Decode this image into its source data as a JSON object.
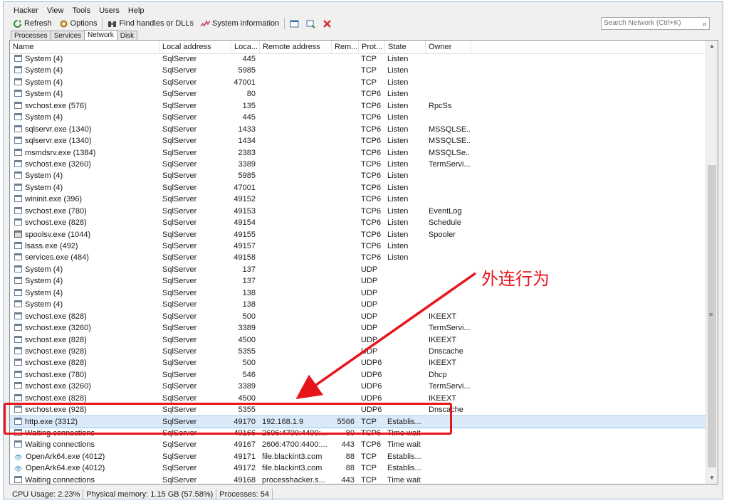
{
  "menu": [
    "Hacker",
    "View",
    "Tools",
    "Users",
    "Help"
  ],
  "toolbar": {
    "refresh": "Refresh",
    "options": "Options",
    "find": "Find handles or DLLs",
    "sysinfo": "System information",
    "search_placeholder": "Search Network (Ctrl+K)"
  },
  "tabs": [
    "Processes",
    "Services",
    "Network",
    "Disk"
  ],
  "columns": [
    "Name",
    "Local address",
    "Loca...",
    "Remote address",
    "Rem...",
    "Prot...",
    "State",
    "Owner"
  ],
  "rows": [
    {
      "icon": "process",
      "name": "System (4)",
      "local": "SqlServer",
      "lport": "445",
      "remote": "",
      "rport": "",
      "proto": "TCP",
      "state": "Listen",
      "owner": ""
    },
    {
      "icon": "process",
      "name": "System (4)",
      "local": "SqlServer",
      "lport": "5985",
      "remote": "",
      "rport": "",
      "proto": "TCP",
      "state": "Listen",
      "owner": ""
    },
    {
      "icon": "process",
      "name": "System (4)",
      "local": "SqlServer",
      "lport": "47001",
      "remote": "",
      "rport": "",
      "proto": "TCP",
      "state": "Listen",
      "owner": ""
    },
    {
      "icon": "process",
      "name": "System (4)",
      "local": "SqlServer",
      "lport": "80",
      "remote": "",
      "rport": "",
      "proto": "TCP6",
      "state": "Listen",
      "owner": ""
    },
    {
      "icon": "process",
      "name": "svchost.exe (576)",
      "local": "SqlServer",
      "lport": "135",
      "remote": "",
      "rport": "",
      "proto": "TCP6",
      "state": "Listen",
      "owner": "RpcSs"
    },
    {
      "icon": "process",
      "name": "System (4)",
      "local": "SqlServer",
      "lport": "445",
      "remote": "",
      "rport": "",
      "proto": "TCP6",
      "state": "Listen",
      "owner": ""
    },
    {
      "icon": "process",
      "name": "sqlservr.exe (1340)",
      "local": "SqlServer",
      "lport": "1433",
      "remote": "",
      "rport": "",
      "proto": "TCP6",
      "state": "Listen",
      "owner": "MSSQLSE..."
    },
    {
      "icon": "process",
      "name": "sqlservr.exe (1340)",
      "local": "SqlServer",
      "lport": "1434",
      "remote": "",
      "rport": "",
      "proto": "TCP6",
      "state": "Listen",
      "owner": "MSSQLSE..."
    },
    {
      "icon": "process",
      "name": "msmdsrv.exe (1384)",
      "local": "SqlServer",
      "lport": "2383",
      "remote": "",
      "rport": "",
      "proto": "TCP6",
      "state": "Listen",
      "owner": "MSSQLSe..."
    },
    {
      "icon": "process",
      "name": "svchost.exe (3260)",
      "local": "SqlServer",
      "lport": "3389",
      "remote": "",
      "rport": "",
      "proto": "TCP6",
      "state": "Listen",
      "owner": "TermServi..."
    },
    {
      "icon": "process",
      "name": "System (4)",
      "local": "SqlServer",
      "lport": "5985",
      "remote": "",
      "rport": "",
      "proto": "TCP6",
      "state": "Listen",
      "owner": ""
    },
    {
      "icon": "process",
      "name": "System (4)",
      "local": "SqlServer",
      "lport": "47001",
      "remote": "",
      "rport": "",
      "proto": "TCP6",
      "state": "Listen",
      "owner": ""
    },
    {
      "icon": "process",
      "name": "wininit.exe (396)",
      "local": "SqlServer",
      "lport": "49152",
      "remote": "",
      "rport": "",
      "proto": "TCP6",
      "state": "Listen",
      "owner": ""
    },
    {
      "icon": "process",
      "name": "svchost.exe (780)",
      "local": "SqlServer",
      "lport": "49153",
      "remote": "",
      "rport": "",
      "proto": "TCP6",
      "state": "Listen",
      "owner": "EventLog"
    },
    {
      "icon": "process",
      "name": "svchost.exe (828)",
      "local": "SqlServer",
      "lport": "49154",
      "remote": "",
      "rport": "",
      "proto": "TCP6",
      "state": "Listen",
      "owner": "Schedule"
    },
    {
      "icon": "printer",
      "name": "spoolsv.exe (1044)",
      "local": "SqlServer",
      "lport": "49155",
      "remote": "",
      "rport": "",
      "proto": "TCP6",
      "state": "Listen",
      "owner": "Spooler"
    },
    {
      "icon": "process",
      "name": "lsass.exe (492)",
      "local": "SqlServer",
      "lport": "49157",
      "remote": "",
      "rport": "",
      "proto": "TCP6",
      "state": "Listen",
      "owner": ""
    },
    {
      "icon": "process",
      "name": "services.exe (484)",
      "local": "SqlServer",
      "lport": "49158",
      "remote": "",
      "rport": "",
      "proto": "TCP6",
      "state": "Listen",
      "owner": ""
    },
    {
      "icon": "process",
      "name": "System (4)",
      "local": "SqlServer",
      "lport": "137",
      "remote": "",
      "rport": "",
      "proto": "UDP",
      "state": "",
      "owner": ""
    },
    {
      "icon": "process",
      "name": "System (4)",
      "local": "SqlServer",
      "lport": "137",
      "remote": "",
      "rport": "",
      "proto": "UDP",
      "state": "",
      "owner": ""
    },
    {
      "icon": "process",
      "name": "System (4)",
      "local": "SqlServer",
      "lport": "138",
      "remote": "",
      "rport": "",
      "proto": "UDP",
      "state": "",
      "owner": ""
    },
    {
      "icon": "process",
      "name": "System (4)",
      "local": "SqlServer",
      "lport": "138",
      "remote": "",
      "rport": "",
      "proto": "UDP",
      "state": "",
      "owner": ""
    },
    {
      "icon": "process",
      "name": "svchost.exe (828)",
      "local": "SqlServer",
      "lport": "500",
      "remote": "",
      "rport": "",
      "proto": "UDP",
      "state": "",
      "owner": "IKEEXT"
    },
    {
      "icon": "process",
      "name": "svchost.exe (3260)",
      "local": "SqlServer",
      "lport": "3389",
      "remote": "",
      "rport": "",
      "proto": "UDP",
      "state": "",
      "owner": "TermServi..."
    },
    {
      "icon": "process",
      "name": "svchost.exe (828)",
      "local": "SqlServer",
      "lport": "4500",
      "remote": "",
      "rport": "",
      "proto": "UDP",
      "state": "",
      "owner": "IKEEXT"
    },
    {
      "icon": "process",
      "name": "svchost.exe (928)",
      "local": "SqlServer",
      "lport": "5355",
      "remote": "",
      "rport": "",
      "proto": "UDP",
      "state": "",
      "owner": "Dnscache"
    },
    {
      "icon": "process",
      "name": "svchost.exe (828)",
      "local": "SqlServer",
      "lport": "500",
      "remote": "",
      "rport": "",
      "proto": "UDP6",
      "state": "",
      "owner": "IKEEXT"
    },
    {
      "icon": "process",
      "name": "svchost.exe (780)",
      "local": "SqlServer",
      "lport": "546",
      "remote": "",
      "rport": "",
      "proto": "UDP6",
      "state": "",
      "owner": "Dhcp"
    },
    {
      "icon": "process",
      "name": "svchost.exe (3260)",
      "local": "SqlServer",
      "lport": "3389",
      "remote": "",
      "rport": "",
      "proto": "UDP6",
      "state": "",
      "owner": "TermServi..."
    },
    {
      "icon": "process",
      "name": "svchost.exe (828)",
      "local": "SqlServer",
      "lport": "4500",
      "remote": "",
      "rport": "",
      "proto": "UDP6",
      "state": "",
      "owner": "IKEEXT"
    },
    {
      "icon": "process",
      "name": "svchost.exe (928)",
      "local": "SqlServer",
      "lport": "5355",
      "remote": "",
      "rport": "",
      "proto": "UDP6",
      "state": "",
      "owner": "Dnscache"
    },
    {
      "icon": "process",
      "name": "http.exe (3312)",
      "local": "SqlServer",
      "lport": "49170",
      "remote": "192.168.1.9",
      "rport": "5566",
      "proto": "TCP",
      "state": "Establis...",
      "owner": "",
      "selected": true
    },
    {
      "icon": "process",
      "name": "Waiting connections",
      "local": "SqlServer",
      "lport": "49166",
      "remote": "2606:4700:4400:...",
      "rport": "80",
      "proto": "TCP6",
      "state": "Time wait",
      "owner": ""
    },
    {
      "icon": "process",
      "name": "Waiting connections",
      "local": "SqlServer",
      "lport": "49167",
      "remote": "2606:4700:4400:...",
      "rport": "443",
      "proto": "TCP6",
      "state": "Time wait",
      "owner": ""
    },
    {
      "icon": "ark",
      "name": "OpenArk64.exe (4012)",
      "local": "SqlServer",
      "lport": "49171",
      "remote": "file.blackint3.com",
      "rport": "88",
      "proto": "TCP",
      "state": "Establis...",
      "owner": ""
    },
    {
      "icon": "ark",
      "name": "OpenArk64.exe (4012)",
      "local": "SqlServer",
      "lport": "49172",
      "remote": "file.blackint3.com",
      "rport": "88",
      "proto": "TCP",
      "state": "Establis...",
      "owner": ""
    },
    {
      "icon": "process",
      "name": "Waiting connections",
      "local": "SqlServer",
      "lport": "49168",
      "remote": "processhacker.s...",
      "rport": "443",
      "proto": "TCP",
      "state": "Time wait",
      "owner": ""
    }
  ],
  "status": {
    "cpu": "CPU Usage: 2.23%",
    "memory": "Physical memory: 1.15 GB (57.58%)",
    "processes": "Processes: 54"
  },
  "annotation": {
    "text": "外连行为",
    "color": "#e8141c"
  },
  "colors": {
    "selection": "#dbeaf9",
    "highlight": "#e8141c"
  }
}
